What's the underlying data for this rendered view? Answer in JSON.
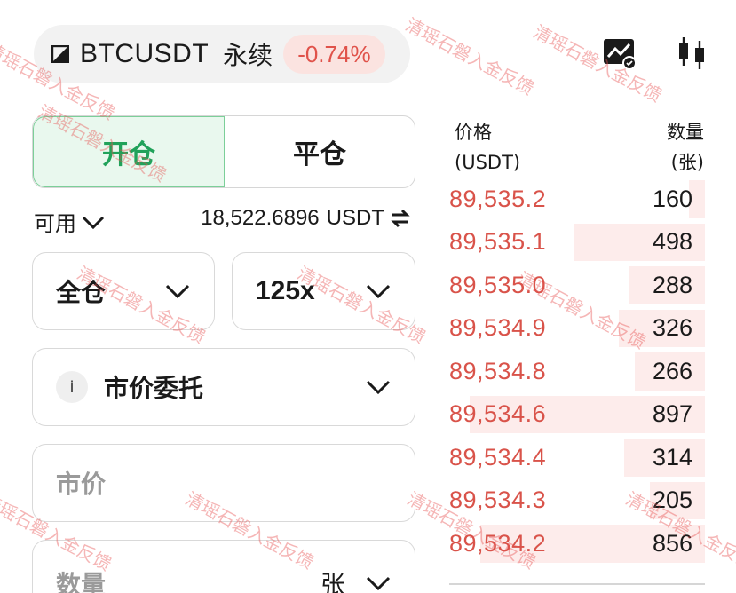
{
  "header": {
    "symbol": "BTCUSDT",
    "contract_type": "永续",
    "change": "-0.74%",
    "icons": [
      "exchange-logo-icon",
      "chart-alert-icon",
      "candlestick-icon"
    ]
  },
  "tabs": {
    "open": "开仓",
    "close": "平仓",
    "active": "open"
  },
  "balance": {
    "label": "可用",
    "amount": "18,522.6896",
    "unit": "USDT"
  },
  "form": {
    "margin_mode": "全仓",
    "leverage": "125x",
    "order_type": "市价委托",
    "info_glyph": "i",
    "price_placeholder": "市价",
    "qty_placeholder": "数量",
    "qty_unit": "张"
  },
  "orderbook": {
    "price_header": "价格",
    "price_unit": "(USDT)",
    "qty_header": "数量",
    "qty_unit": "(张)",
    "asks": [
      {
        "price": "89,535.2",
        "qty": "160",
        "depth": 0.06
      },
      {
        "price": "89,535.1",
        "qty": "498",
        "depth": 0.5
      },
      {
        "price": "89,535.0",
        "qty": "288",
        "depth": 0.29
      },
      {
        "price": "89,534.9",
        "qty": "326",
        "depth": 0.33
      },
      {
        "price": "89,534.8",
        "qty": "266",
        "depth": 0.27
      },
      {
        "price": "89,534.6",
        "qty": "897",
        "depth": 0.9
      },
      {
        "price": "89,534.4",
        "qty": "314",
        "depth": 0.31
      },
      {
        "price": "89,534.3",
        "qty": "205",
        "depth": 0.21
      },
      {
        "price": "89,534.2",
        "qty": "856",
        "depth": 0.86
      }
    ]
  },
  "watermark": "清瑶石磐入金反馈",
  "colors": {
    "up_green": "#21a25a",
    "down_red": "#d9534a",
    "badge_bg": "#fbe3e0",
    "depth_bg": "#fdeceb"
  }
}
